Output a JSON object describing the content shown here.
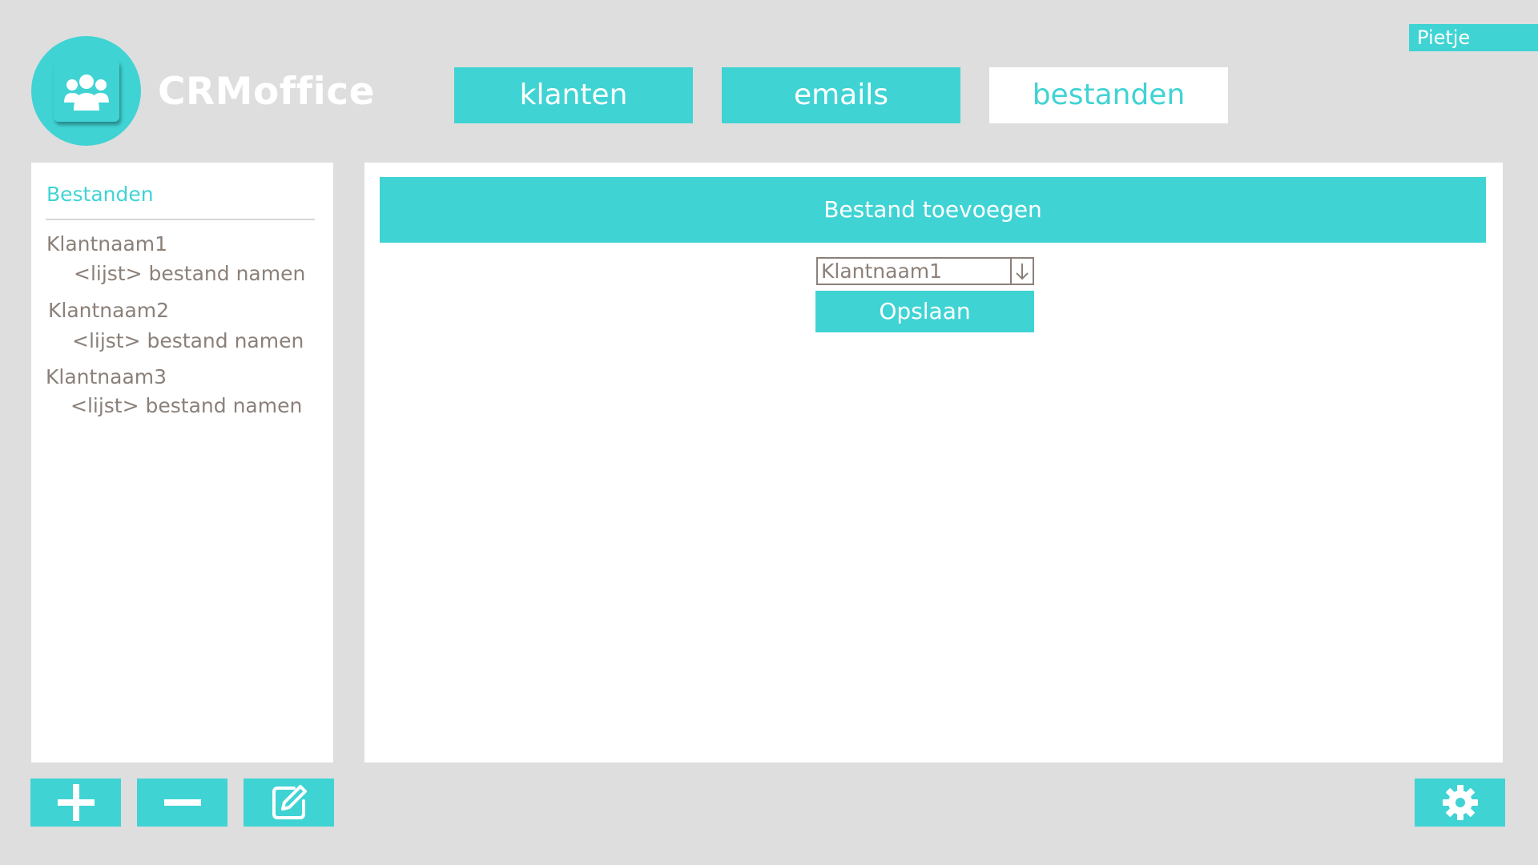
{
  "app": {
    "title": "CRMoffice",
    "logo_icon": "users-group-icon"
  },
  "user": {
    "name": "Pietje"
  },
  "tabs": [
    {
      "label": "klanten",
      "active": false
    },
    {
      "label": "emails",
      "active": false
    },
    {
      "label": "bestanden",
      "active": true
    }
  ],
  "sidebar": {
    "title": "Bestanden",
    "clients": [
      {
        "name": "Klantnaam1",
        "files": "<lijst> bestand namen"
      },
      {
        "name": "Klantnaam2",
        "files": "<lijst> bestand namen"
      },
      {
        "name": "Klantnaam3",
        "files": "<lijst> bestand namen"
      }
    ]
  },
  "main": {
    "header": "Bestand toevoegen",
    "client_select": {
      "value": "Klantnaam1",
      "icon": "arrow-down-icon"
    },
    "save_label": "Opslaan"
  },
  "actions": {
    "add_icon": "plus-icon",
    "remove_icon": "minus-icon",
    "edit_icon": "edit-icon",
    "settings_icon": "gear-icon"
  },
  "colors": {
    "accent": "#40d3d4",
    "background": "#dedede",
    "text": "#8b8079",
    "panel": "#ffffff"
  }
}
